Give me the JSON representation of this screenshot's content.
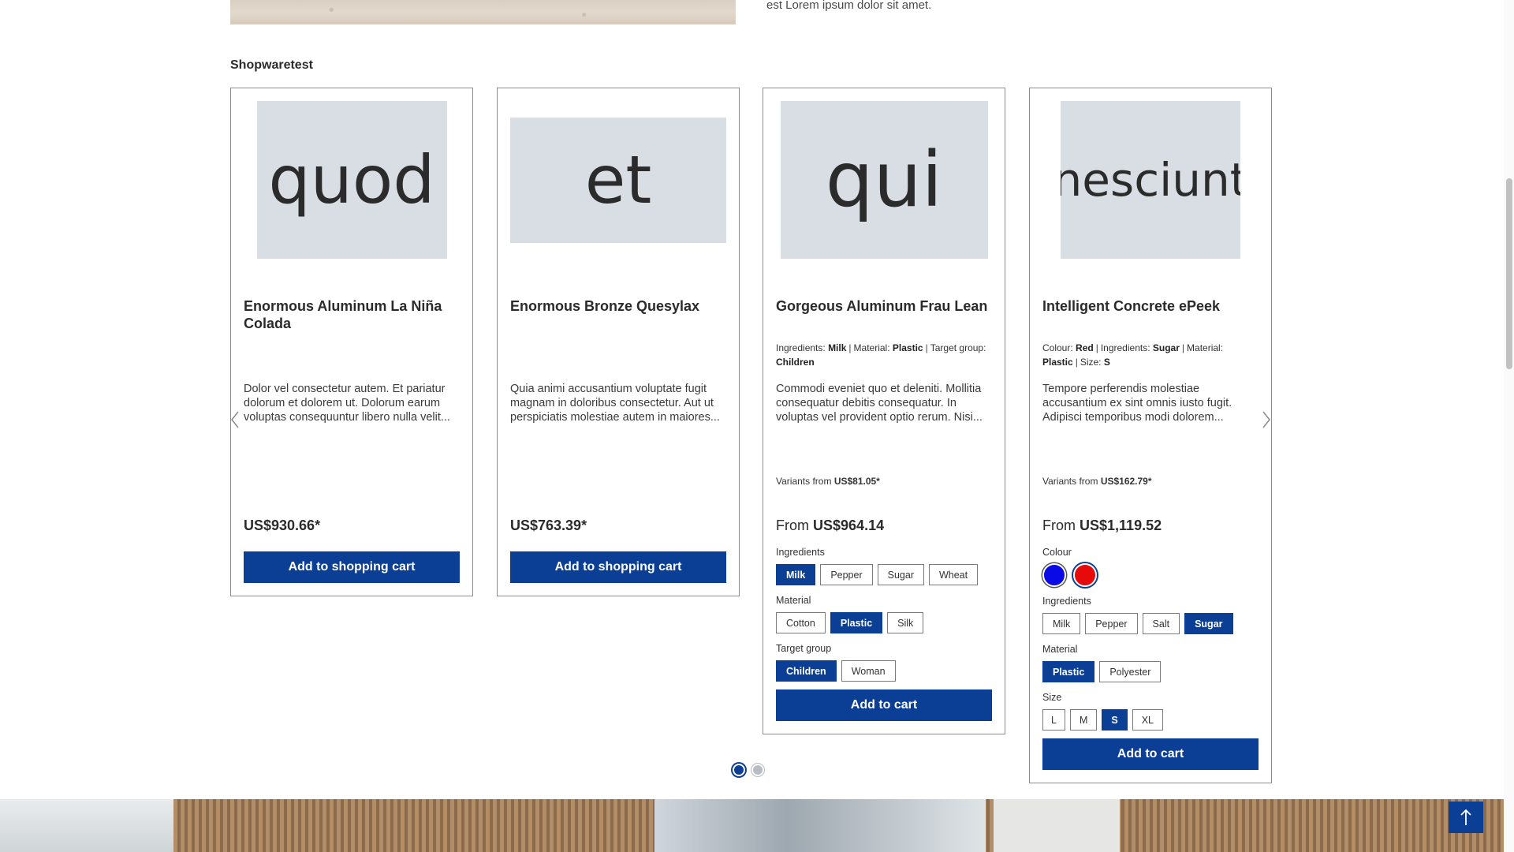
{
  "top": {
    "text": "est Lorem ipsum dolor sit amet."
  },
  "section": {
    "title": "Shopwaretest"
  },
  "products": [
    {
      "image_text": "quod",
      "name": "Enormous Aluminum La Niña Colada",
      "description": "Dolor vel consectetur autem. Et pariatur dolorum et dolorem ut. Dolorum earum voluptas consequuntur libero nulla velit...",
      "price": "US$930.66*",
      "button": "Add to shopping cart"
    },
    {
      "image_text": "et",
      "name": "Enormous Bronze Quesylax",
      "description": "Quia animi accusantium voluptate fugit magnam in doloribus consectetur. Aut ut perspiciatis molestiae autem in maiores...",
      "price": "US$763.39*",
      "button": "Add to shopping cart"
    },
    {
      "image_text": "qui",
      "name": "Gorgeous Aluminum Frau Lean",
      "props": [
        {
          "label": "Ingredients:",
          "value": "Milk"
        },
        {
          "label": "Material:",
          "value": "Plastic"
        },
        {
          "label": "Target group:",
          "value": "Children"
        }
      ],
      "description": "Commodi eveniet quo et deleniti. Mollitia consequatur debitis consequatur. In voluptas vel provident optio rerum. Nisi...",
      "variants_label": "Variants from",
      "variants_price": "US$81.05*",
      "price_from": "From",
      "price": "US$964.14",
      "options": [
        {
          "label": "Ingredients",
          "values": [
            "Milk",
            "Pepper",
            "Sugar",
            "Wheat"
          ],
          "selected": "Milk"
        },
        {
          "label": "Material",
          "values": [
            "Cotton",
            "Plastic",
            "Silk"
          ],
          "selected": "Plastic"
        },
        {
          "label": "Target group",
          "values": [
            "Children",
            "Woman"
          ],
          "selected": "Children"
        }
      ],
      "button": "Add to cart"
    },
    {
      "image_text": "nesciunt",
      "name": "Intelligent Concrete ePeek",
      "props": [
        {
          "label": "Colour:",
          "value": "Red"
        },
        {
          "label": "Ingredients:",
          "value": "Sugar"
        },
        {
          "label": "Material:",
          "value": "Plastic"
        },
        {
          "label": "Size:",
          "value": "S"
        }
      ],
      "description": "Tempore perferendis molestiae accusantium ex sint omnis iusto fugit. Adipisci temporibus modi dolorem...",
      "variants_label": "Variants from",
      "variants_price": "US$162.79*",
      "price_from": "From",
      "price": "US$1,119.52",
      "colour_label": "Colour",
      "colours": [
        {
          "name": "Blue",
          "hex": "#0a0ae6"
        },
        {
          "name": "Red",
          "hex": "#e60a0a"
        }
      ],
      "colour_selected": "Red",
      "options": [
        {
          "label": "Ingredients",
          "values": [
            "Milk",
            "Pepper",
            "Salt",
            "Sugar"
          ],
          "selected": "Sugar"
        },
        {
          "label": "Material",
          "values": [
            "Plastic",
            "Polyester"
          ],
          "selected": "Plastic"
        },
        {
          "label": "Size",
          "values": [
            "L",
            "M",
            "S",
            "XL"
          ],
          "selected": "S"
        }
      ],
      "button": "Add to cart"
    }
  ],
  "carousel": {
    "pages": 2,
    "active": 1,
    "prev_icon": "chevron-left-icon",
    "next_icon": "chevron-right-icon"
  },
  "colors": {
    "primary": "#0b3f96",
    "placeholder": "#d9dde4"
  }
}
